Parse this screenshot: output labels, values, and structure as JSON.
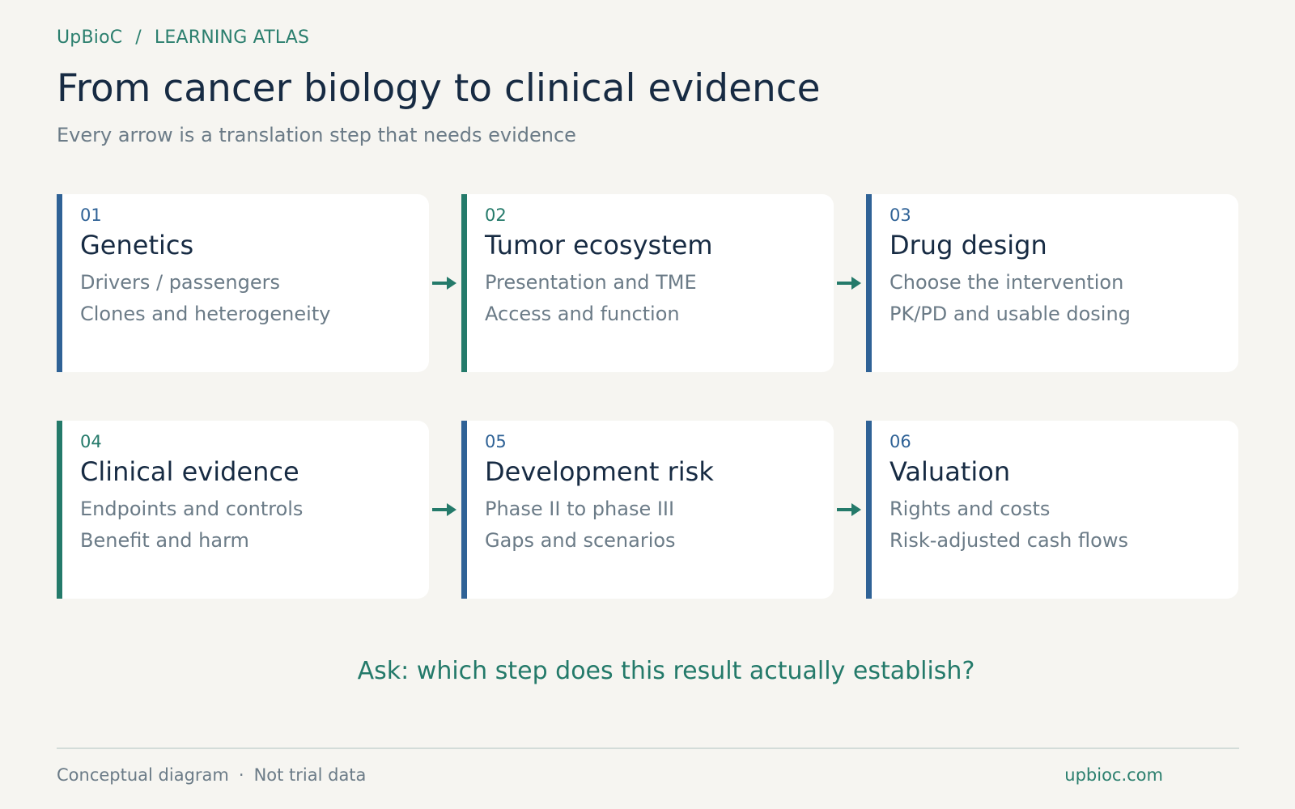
{
  "breadcrumb": {
    "brand": "UpBioC",
    "separator": "/",
    "section": "LEARNING ATLAS"
  },
  "title": "From cancer biology to clinical evidence",
  "subtitle": "Every arrow is a translation step that needs evidence",
  "colors": {
    "blue_accent": "#2f6296",
    "green_accent": "#247a6a",
    "title": "#172b43",
    "muted": "#6b7b87",
    "background": "#f6f5f1"
  },
  "steps": [
    {
      "number": "01",
      "title": "Genetics",
      "lines": [
        "Drivers / passengers",
        "Clones and heterogeneity"
      ],
      "accent": "blue"
    },
    {
      "number": "02",
      "title": "Tumor ecosystem",
      "lines": [
        "Presentation and TME",
        "Access and function"
      ],
      "accent": "green"
    },
    {
      "number": "03",
      "title": "Drug design",
      "lines": [
        "Choose the intervention",
        "PK/PD and usable dosing"
      ],
      "accent": "blue"
    },
    {
      "number": "04",
      "title": "Clinical evidence",
      "lines": [
        "Endpoints and controls",
        "Benefit and harm"
      ],
      "accent": "green"
    },
    {
      "number": "05",
      "title": "Development risk",
      "lines": [
        "Phase II to phase III",
        "Gaps and scenarios"
      ],
      "accent": "blue"
    },
    {
      "number": "06",
      "title": "Valuation",
      "lines": [
        "Rights and costs",
        "Risk-adjusted cash flows"
      ],
      "accent": "blue"
    }
  ],
  "arrow_icon": "right-arrow-icon",
  "prompt": "Ask: which step does this result actually establish?",
  "footer": {
    "left_1": "Conceptual diagram",
    "dot": "·",
    "left_2": "Not trial data",
    "right": "upbioc.com"
  }
}
